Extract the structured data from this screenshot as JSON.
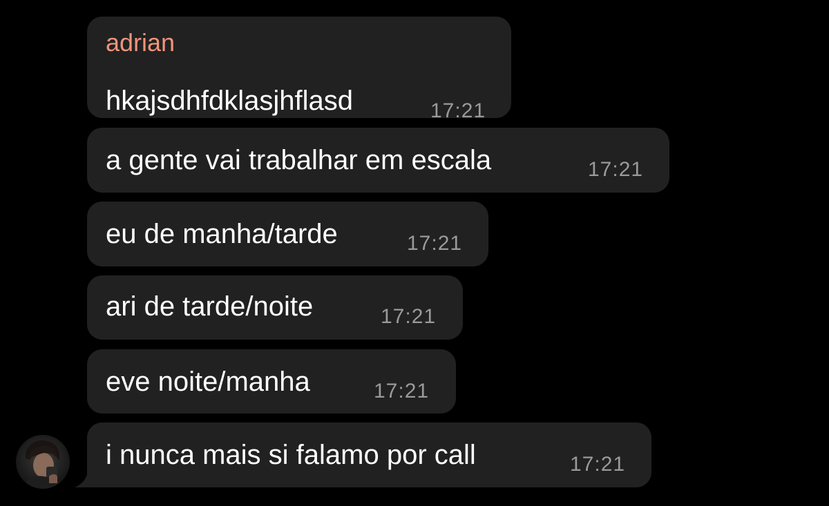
{
  "colors": {
    "background": "#000000",
    "bubble": "#212121",
    "sender_name": "#f0947a",
    "message_text": "#ffffff",
    "timestamp": "#9a9a9a"
  },
  "chat": {
    "sender": "adrian",
    "messages": [
      {
        "text": "hkajsdhfdklasjhflasd",
        "time": "17:21"
      },
      {
        "text": "a gente vai trabalhar em escala",
        "time": "17:21"
      },
      {
        "text": "eu de manha/tarde",
        "time": "17:21"
      },
      {
        "text": "ari de tarde/noite",
        "time": "17:21"
      },
      {
        "text": "eve noite/manha",
        "time": "17:21"
      },
      {
        "text": "i nunca mais si falamo por call",
        "time": "17:21"
      }
    ],
    "avatar_icon": "user-photo-avatar"
  }
}
